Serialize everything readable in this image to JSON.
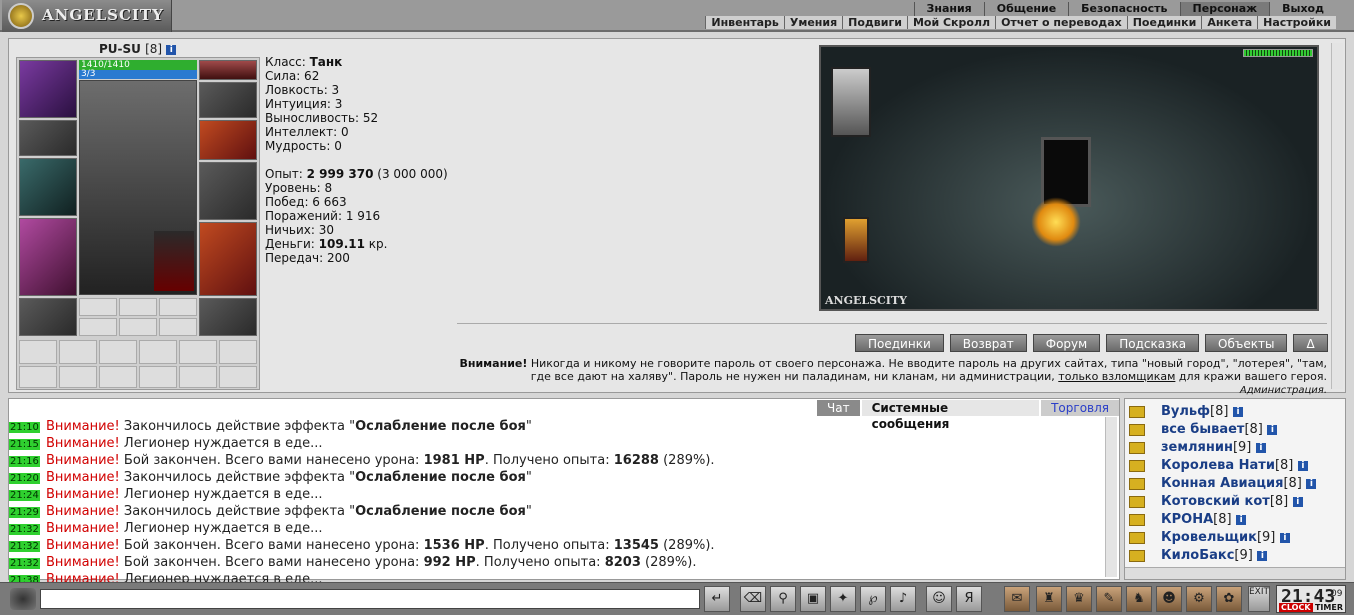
{
  "header": {
    "logo": "ANGELSCITY",
    "nav_main": [
      "Знания",
      "Общение",
      "Безопасность",
      "Персонаж",
      "Выход"
    ],
    "nav_sub": [
      "Инвентарь",
      "Умения",
      "Подвиги",
      "Мой Скролл",
      "Отчет о переводах",
      "Поединки",
      "Анкета",
      "Настройки"
    ]
  },
  "character": {
    "name": "PU-SU",
    "level": "[8]",
    "hp": "1410/1410",
    "mp": "3/3"
  },
  "stats": {
    "class_label": "Класс:",
    "class_value": "Танк",
    "strength": "Сила: 62",
    "agility": "Ловкость: 3",
    "intuition": "Интуиция: 3",
    "endurance": "Выносливость: 52",
    "intellect": "Интеллект: 0",
    "wisdom": "Мудрость: 0",
    "exp_label": "Опыт:",
    "exp_value": "2 999 370",
    "exp_next": "(3 000 000)",
    "level": "Уровень: 8",
    "wins": "Побед: 6 663",
    "losses": "Поражений: 1 916",
    "draws": "Ничьих: 30",
    "money_label": "Деньги:",
    "money_value": "109.11",
    "money_unit": "кр.",
    "transfers": "Передач: 200"
  },
  "scene": {
    "label": "ANGELSCITY"
  },
  "actions": [
    "Поединки",
    "Возврат",
    "Форум",
    "Подсказка",
    "Объекты",
    "Δ"
  ],
  "warning": {
    "bold": "Внимание!",
    "text1": "Никогда и никому не говорите пароль от своего персонажа. Не вводите пароль на других сайтах, типа \"новый город\", \"лотерея\", \"там, где все дают на халяву\". Пароль не нужен ни паладинам, ни кланам, ни администрации,",
    "link": "только взломщикам",
    "text2": "для кражи вашего героя.",
    "admin": "Администрация."
  },
  "chat_tabs": [
    "Чат",
    "Системные сообщения",
    "Торговля"
  ],
  "chat": [
    {
      "time": "21:10",
      "att": "Внимание!",
      "pre": "Закончилось действие эффекта \"",
      "bold": "Ослабление после боя",
      "post": "\""
    },
    {
      "time": "21:15",
      "att": "Внимание!",
      "pre": "Легионер нуждается в еде...",
      "bold": "",
      "post": ""
    },
    {
      "time": "21:16",
      "att": "Внимание!",
      "pre": "Бой закончен. Всего вами нанесено урона: ",
      "bold": "1981 HP",
      "mid": ". Получено опыта: ",
      "bold2": "16288",
      "post": " (289%)."
    },
    {
      "time": "21:20",
      "att": "Внимание!",
      "pre": "Закончилось действие эффекта \"",
      "bold": "Ослабление после боя",
      "post": "\""
    },
    {
      "time": "21:24",
      "att": "Внимание!",
      "pre": "Легионер нуждается в еде...",
      "bold": "",
      "post": ""
    },
    {
      "time": "21:29",
      "att": "Внимание!",
      "pre": "Закончилось действие эффекта \"",
      "bold": "Ослабление после боя",
      "post": "\""
    },
    {
      "time": "21:32",
      "att": "Внимание!",
      "pre": "Легионер нуждается в еде...",
      "bold": "",
      "post": ""
    },
    {
      "time": "21:32",
      "att": "Внимание!",
      "pre": "Бой закончен. Всего вами нанесено урона: ",
      "bold": "1536 HP",
      "mid": ". Получено опыта: ",
      "bold2": "13545",
      "post": " (289%)."
    },
    {
      "time": "21:32",
      "att": "Внимание!",
      "pre": "Бой закончен. Всего вами нанесено урона: ",
      "bold": "992 HP",
      "mid": ". Получено опыта: ",
      "bold2": "8203",
      "post": " (289%)."
    },
    {
      "time": "21:38",
      "att": "Внимание!",
      "pre": "Легионер нуждается в еде...",
      "bold": "",
      "post": ""
    }
  ],
  "who_online": [
    {
      "name": "Вульф",
      "level": "[8]"
    },
    {
      "name": "все бывает",
      "level": "[8]"
    },
    {
      "name": "землянин",
      "level": "[9]"
    },
    {
      "name": "Королева Нати",
      "level": "[8]"
    },
    {
      "name": "Конная Авиация",
      "level": "[8]"
    },
    {
      "name": "Котовский кот",
      "level": "[8]"
    },
    {
      "name": "КРОНА",
      "level": "[8]"
    },
    {
      "name": "Кровельщик",
      "level": "[9]"
    },
    {
      "name": "КилоБакс",
      "level": "[9]"
    }
  ],
  "clock": {
    "time": "21:43",
    "seconds": "09",
    "clock_label": "CLOCK",
    "timer_label": "TIMER",
    "exit_label": "EXIT"
  }
}
